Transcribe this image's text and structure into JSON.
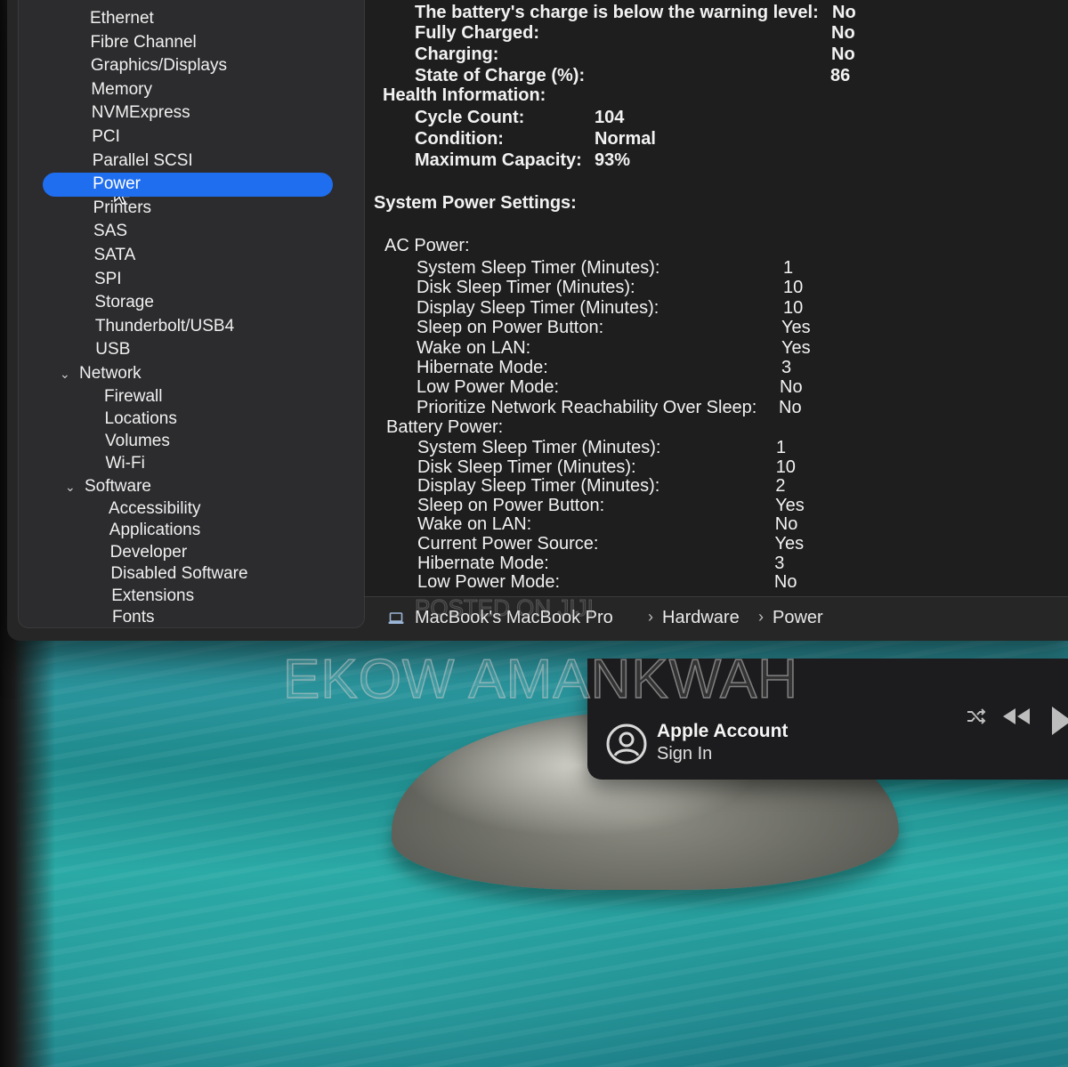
{
  "sidebar": {
    "hardware_items": [
      "Ethernet",
      "Fibre Channel",
      "Graphics/Displays",
      "Memory",
      "NVMExpress",
      "PCI",
      "Parallel SCSI",
      "Power",
      "Printers",
      "SAS",
      "SATA",
      "SPI",
      "Storage",
      "Thunderbolt/USB4",
      "USB"
    ],
    "network": {
      "label": "Network",
      "items": [
        "Firewall",
        "Locations",
        "Volumes",
        "Wi-Fi"
      ]
    },
    "software": {
      "label": "Software",
      "items": [
        "Accessibility",
        "Applications",
        "Developer",
        "Disabled Software",
        "Extensions",
        "Fonts"
      ]
    },
    "selected": "Power"
  },
  "battery": {
    "warning_label": "The battery's charge is below the warning level:",
    "warning_value": "No",
    "fully_charged_label": "Fully Charged:",
    "fully_charged_value": "No",
    "charging_label": "Charging:",
    "charging_value": "No",
    "soc_label": "State of Charge (%):",
    "soc_value": "86"
  },
  "health": {
    "header": "Health Information:",
    "cycle_label": "Cycle Count:",
    "cycle_value": "104",
    "condition_label": "Condition:",
    "condition_value": "Normal",
    "capacity_label": "Maximum Capacity:",
    "capacity_value": "93%"
  },
  "power_settings": {
    "header": "System Power Settings:",
    "ac": {
      "header": "AC Power:",
      "rows": [
        {
          "label": "System Sleep Timer (Minutes):",
          "value": "1"
        },
        {
          "label": "Disk Sleep Timer (Minutes):",
          "value": "10"
        },
        {
          "label": "Display Sleep Timer (Minutes):",
          "value": "10"
        },
        {
          "label": "Sleep on Power Button:",
          "value": "Yes"
        },
        {
          "label": "Wake on LAN:",
          "value": "Yes"
        },
        {
          "label": "Hibernate Mode:",
          "value": "3"
        },
        {
          "label": "Low Power Mode:",
          "value": "No"
        },
        {
          "label": "Prioritize Network Reachability Over Sleep:",
          "value": "No"
        }
      ]
    },
    "battery": {
      "header": "Battery Power:",
      "rows": [
        {
          "label": "System Sleep Timer (Minutes):",
          "value": "1"
        },
        {
          "label": "Disk Sleep Timer (Minutes):",
          "value": "10"
        },
        {
          "label": "Display Sleep Timer (Minutes):",
          "value": "2"
        },
        {
          "label": "Sleep on Power Button:",
          "value": "Yes"
        },
        {
          "label": "Wake on LAN:",
          "value": "No"
        },
        {
          "label": "Current Power Source:",
          "value": "Yes"
        },
        {
          "label": "Hibernate Mode:",
          "value": "3"
        },
        {
          "label": "Low Power Mode:",
          "value": "No"
        }
      ]
    }
  },
  "pathbar": {
    "computer": "MacBook's MacBook Pro",
    "section": "Hardware",
    "page": "Power",
    "separator": "›",
    "icon": "laptop-icon"
  },
  "account": {
    "title": "Apple Account",
    "subtitle": "Sign In",
    "icons": [
      "person-circle-icon",
      "shuffle-icon",
      "rewind-icon",
      "play-icon"
    ]
  },
  "watermark": {
    "top": "POSTED ON JIJI",
    "main": "EKOW AMANKWAH"
  },
  "colors": {
    "selection": "#1f6ef0",
    "window_bg": "#1e1e1e",
    "sidebar_bg": "#2c2c2e"
  }
}
